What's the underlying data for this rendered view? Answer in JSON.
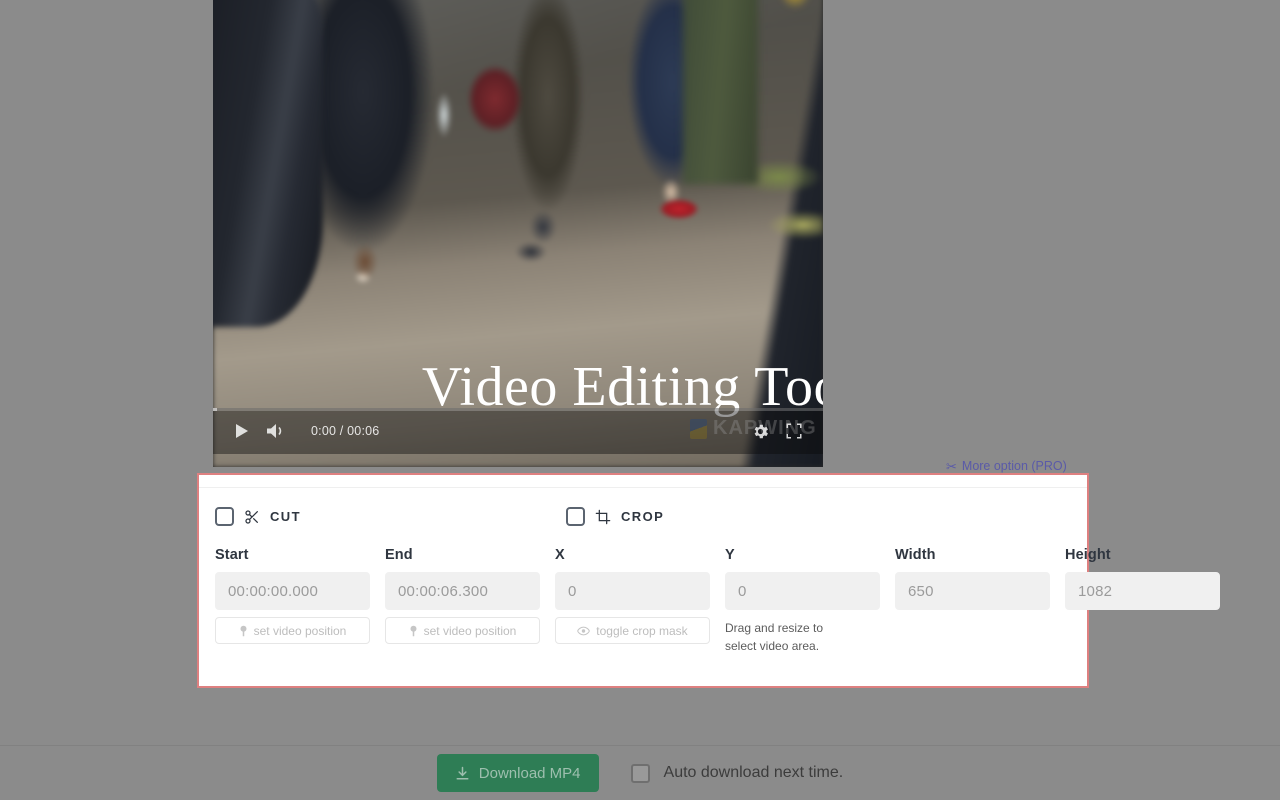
{
  "video": {
    "overlay_title": "Video Editing Tool",
    "watermark": "KAPWING",
    "current_time": "0:00",
    "duration": "00:06",
    "time_display": "0:00 / 00:06",
    "controls": {
      "play": "play-icon",
      "volume": "volume-icon",
      "settings": "gear-icon",
      "fullscreen": "fullscreen-icon"
    }
  },
  "more_option": {
    "label": "More option (PRO)",
    "icon": "scissors-icon",
    "color": "#5a5aa8"
  },
  "panel": {
    "border_color": "#de8080",
    "modes": [
      {
        "key": "cut",
        "label": "CUT",
        "icon": "scissors-icon",
        "checked": false
      },
      {
        "key": "crop",
        "label": "CROP",
        "icon": "crop-icon",
        "checked": false
      }
    ],
    "fields": [
      {
        "name": "start",
        "label": "Start",
        "value": "00:00:00.000",
        "placeholder": "00:00:00.000",
        "button": {
          "label": "set video position",
          "icon": "pin-icon"
        }
      },
      {
        "name": "end",
        "label": "End",
        "value": "00:00:06.300",
        "placeholder": "00:00:06.300",
        "button": {
          "label": "set video position",
          "icon": "pin-icon"
        }
      },
      {
        "name": "x",
        "label": "X",
        "value": "0",
        "placeholder": "0",
        "button": {
          "label": "toggle crop mask",
          "icon": "eye-icon"
        }
      },
      {
        "name": "y",
        "label": "Y",
        "value": "0",
        "placeholder": "0",
        "hint": "Drag and resize to select video area."
      },
      {
        "name": "width",
        "label": "Width",
        "value": "650",
        "placeholder": "650"
      },
      {
        "name": "height",
        "label": "Height",
        "value": "1082",
        "placeholder": "1082"
      }
    ]
  },
  "footer": {
    "download_label": "Download MP4",
    "download_icon": "download-icon",
    "download_color": "#2e7d55",
    "auto_download_label": "Auto download next time.",
    "auto_download_checked": false
  }
}
